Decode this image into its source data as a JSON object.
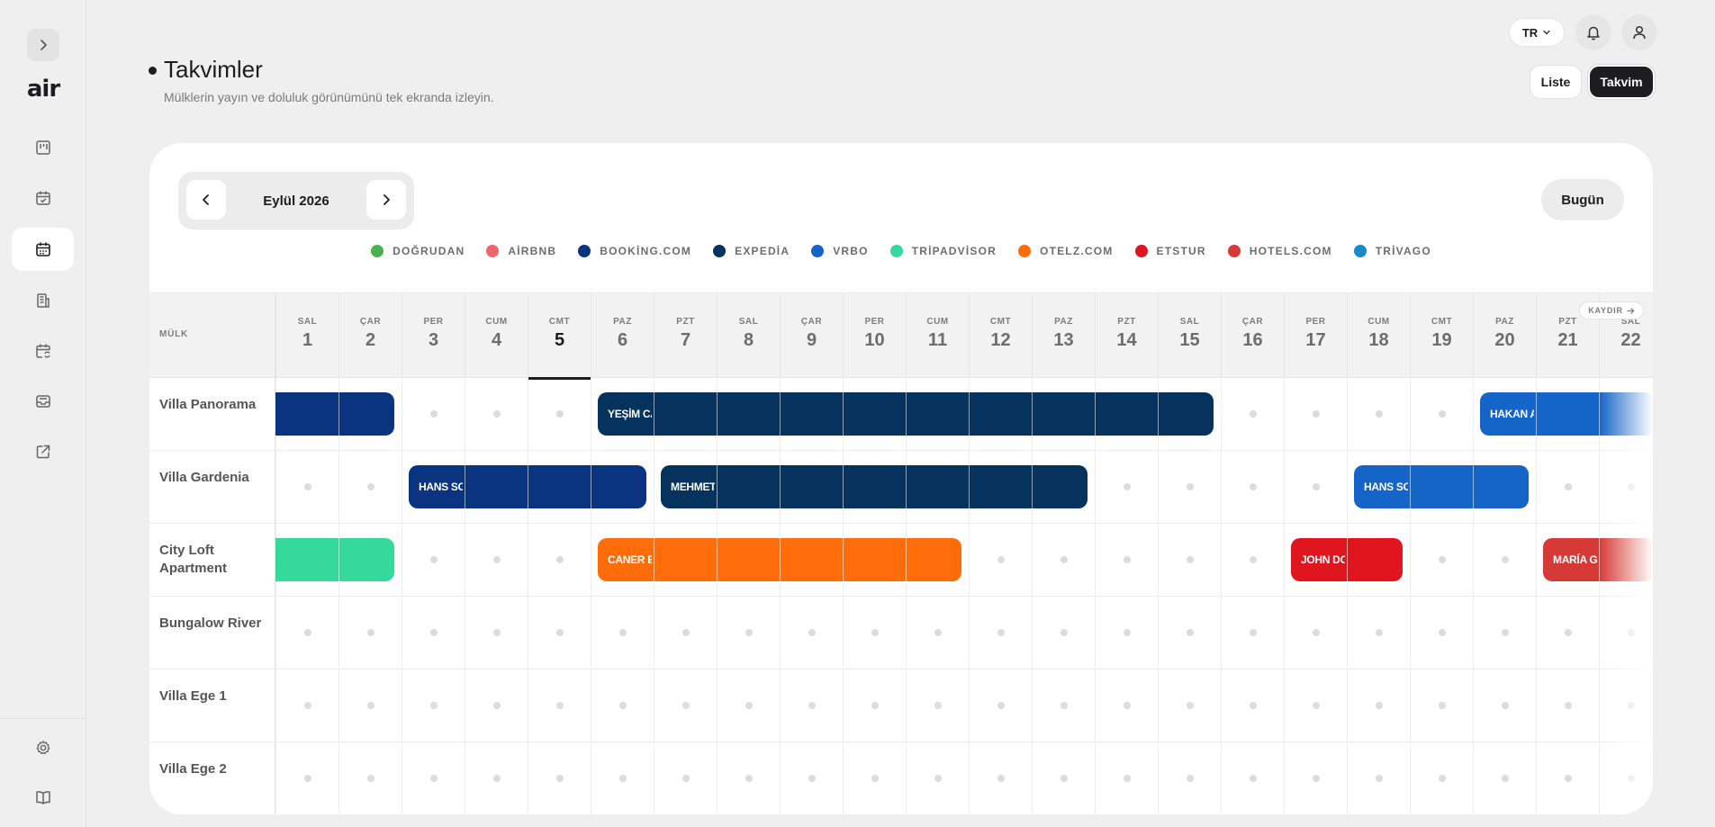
{
  "header": {
    "lang": "TR",
    "title": "Takvimler",
    "subtitle": "Mülklerin yayın ve doluluk görünümünü tek ekranda izleyin.",
    "view_list": "Liste",
    "view_calendar": "Takvim"
  },
  "sidebar": {
    "logo": "air",
    "items": [
      {
        "icon": "board-icon"
      },
      {
        "icon": "calendar-check-icon"
      },
      {
        "icon": "calendar-icon",
        "active": true
      },
      {
        "icon": "building-icon"
      },
      {
        "icon": "calendar-sync-icon"
      },
      {
        "icon": "inbox-icon"
      },
      {
        "icon": "external-link-icon"
      }
    ],
    "bottom": [
      {
        "icon": "settings-icon"
      },
      {
        "icon": "book-icon"
      }
    ]
  },
  "calendar": {
    "month": "Eylül 2026",
    "today_label": "Bugün",
    "property_header": "MÜLK",
    "scroll_hint": "KAYDIR",
    "current_day": 5
  },
  "legend": [
    {
      "label": "DOĞRUDAN",
      "color": "#4caf50"
    },
    {
      "label": "AİRBNB",
      "color": "#f0656b"
    },
    {
      "label": "BOOKİNG.COM",
      "color": "#0a3480"
    },
    {
      "label": "EXPEDİA",
      "color": "#06325e"
    },
    {
      "label": "VRBO",
      "color": "#1565c8"
    },
    {
      "label": "TRİPADVİSOR",
      "color": "#34d99b"
    },
    {
      "label": "OTELZ.COM",
      "color": "#ff6d0a"
    },
    {
      "label": "ETSTUR",
      "color": "#e0161e"
    },
    {
      "label": "HOTELS.COM",
      "color": "#d63a37"
    },
    {
      "label": "TRİVAGO",
      "color": "#1a8ac7"
    }
  ],
  "days": [
    {
      "dow": "SAL",
      "num": "1"
    },
    {
      "dow": "ÇAR",
      "num": "2"
    },
    {
      "dow": "PER",
      "num": "3"
    },
    {
      "dow": "CUM",
      "num": "4"
    },
    {
      "dow": "CMT",
      "num": "5"
    },
    {
      "dow": "PAZ",
      "num": "6"
    },
    {
      "dow": "PZT",
      "num": "7"
    },
    {
      "dow": "SAL",
      "num": "8"
    },
    {
      "dow": "ÇAR",
      "num": "9"
    },
    {
      "dow": "PER",
      "num": "10"
    },
    {
      "dow": "CUM",
      "num": "11"
    },
    {
      "dow": "CMT",
      "num": "12"
    },
    {
      "dow": "PAZ",
      "num": "13"
    },
    {
      "dow": "PZT",
      "num": "14"
    },
    {
      "dow": "SAL",
      "num": "15"
    },
    {
      "dow": "ÇAR",
      "num": "16"
    },
    {
      "dow": "PER",
      "num": "17"
    },
    {
      "dow": "CUM",
      "num": "18"
    },
    {
      "dow": "CMT",
      "num": "19"
    },
    {
      "dow": "PAZ",
      "num": "20"
    },
    {
      "dow": "PZT",
      "num": "21"
    },
    {
      "dow": "SAL",
      "num": "22"
    }
  ],
  "properties": [
    {
      "name": "Villa Panorama",
      "bookings": [
        {
          "guest": "",
          "start": 1,
          "end": 2,
          "color": "#0a3480"
        },
        {
          "guest": "YEŞİM CA",
          "start": 6,
          "end": 15,
          "color": "#06325e"
        },
        {
          "guest": "HAKAN A",
          "start": 20,
          "end": 22,
          "color": "#1565c8"
        }
      ]
    },
    {
      "name": "Villa Gardenia",
      "bookings": [
        {
          "guest": "HANS SC",
          "start": 3,
          "end": 6,
          "color": "#0a3480"
        },
        {
          "guest": "MEHMET",
          "start": 7,
          "end": 13,
          "color": "#06325e"
        },
        {
          "guest": "HANS SC",
          "start": 18,
          "end": 20,
          "color": "#1565c8"
        }
      ]
    },
    {
      "name": "City Loft Apartment",
      "bookings": [
        {
          "guest": "",
          "start": 1,
          "end": 2,
          "color": "#34d99b"
        },
        {
          "guest": "CANER EI",
          "start": 6,
          "end": 11,
          "color": "#ff6d0a"
        },
        {
          "guest": "JOHN DO",
          "start": 17,
          "end": 18,
          "color": "#e0161e"
        },
        {
          "guest": "MARÍA G",
          "start": 21,
          "end": 22,
          "color": "#d63a37"
        }
      ]
    },
    {
      "name": "Bungalow River",
      "bookings": []
    },
    {
      "name": "Villa Ege 1",
      "bookings": []
    },
    {
      "name": "Villa Ege 2",
      "bookings": []
    }
  ]
}
